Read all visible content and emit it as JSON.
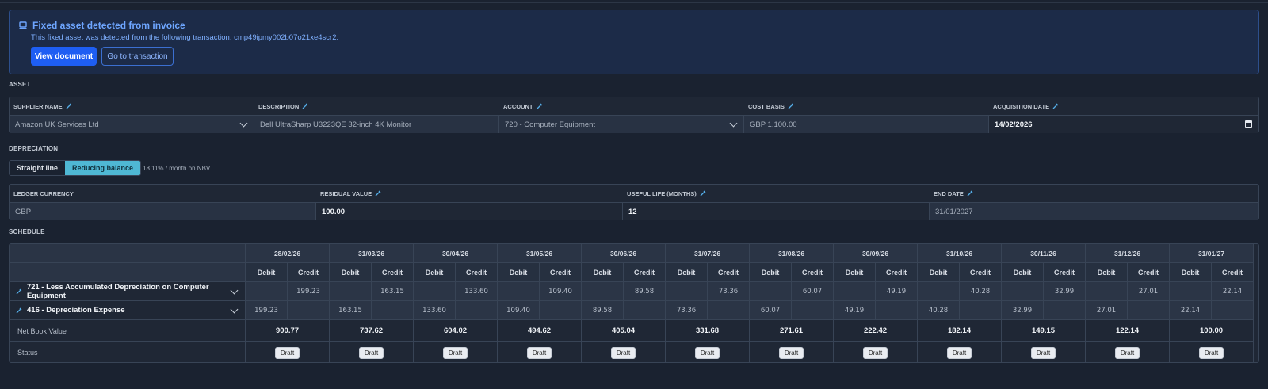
{
  "banner": {
    "title": "Fixed asset detected from invoice",
    "subtitle": "This fixed asset was detected from the following transaction: cmp49ipmy002b07o21xe4scr2.",
    "view_document": "View document",
    "go_to_transaction": "Go to transaction"
  },
  "asset": {
    "section": "ASSET",
    "supplier_label": "SUPPLIER NAME",
    "supplier_value": "Amazon UK Services Ltd",
    "description_label": "DESCRIPTION",
    "description_value": "Dell UltraSharp U3223QE 32-inch 4K Monitor",
    "account_label": "ACCOUNT",
    "account_value": "720 - Computer Equipment",
    "cost_label": "COST BASIS",
    "cost_value": "GBP 1,100.00",
    "acq_label": "ACQUISITION DATE",
    "acq_value": "14/02/2026"
  },
  "depreciation": {
    "section": "DEPRECIATION",
    "methods": [
      "Straight line",
      "Reducing balance"
    ],
    "active_method": "Reducing balance",
    "rate_note": "18.11% / month on NBV",
    "currency_label": "LEDGER CURRENCY",
    "currency_value": "GBP",
    "residual_label": "RESIDUAL VALUE",
    "residual_value": "100.00",
    "life_label": "USEFUL LIFE (MONTHS)",
    "life_value": "12",
    "end_label": "END DATE",
    "end_value": "31/01/2027"
  },
  "schedule": {
    "section": "SCHEDULE",
    "debit_label": "Debit",
    "credit_label": "Credit",
    "dates": [
      "28/02/26",
      "31/03/26",
      "30/04/26",
      "31/05/26",
      "30/06/26",
      "31/07/26",
      "31/08/26",
      "30/09/26",
      "31/10/26",
      "30/11/26",
      "31/12/26",
      "31/01/27"
    ],
    "accounts": [
      {
        "label": "721 - Less Accumulated Depreciation on Computer Equipment",
        "side": "credit",
        "values": [
          "199.23",
          "163.15",
          "133.60",
          "109.40",
          "89.58",
          "73.36",
          "60.07",
          "49.19",
          "40.28",
          "32.99",
          "27.01",
          "22.14"
        ]
      },
      {
        "label": "416 - Depreciation Expense",
        "side": "debit",
        "values": [
          "199.23",
          "163.15",
          "133.60",
          "109.40",
          "89.58",
          "73.36",
          "60.07",
          "49.19",
          "40.28",
          "32.99",
          "27.01",
          "22.14"
        ]
      }
    ],
    "nbv_label": "Net Book Value",
    "nbv": [
      "900.77",
      "737.62",
      "604.02",
      "494.62",
      "405.04",
      "331.68",
      "271.61",
      "222.42",
      "182.14",
      "149.15",
      "122.14",
      "100.00"
    ],
    "status_label": "Status",
    "status": [
      "Draft",
      "Draft",
      "Draft",
      "Draft",
      "Draft",
      "Draft",
      "Draft",
      "Draft",
      "Draft",
      "Draft",
      "Draft",
      "Draft"
    ]
  }
}
